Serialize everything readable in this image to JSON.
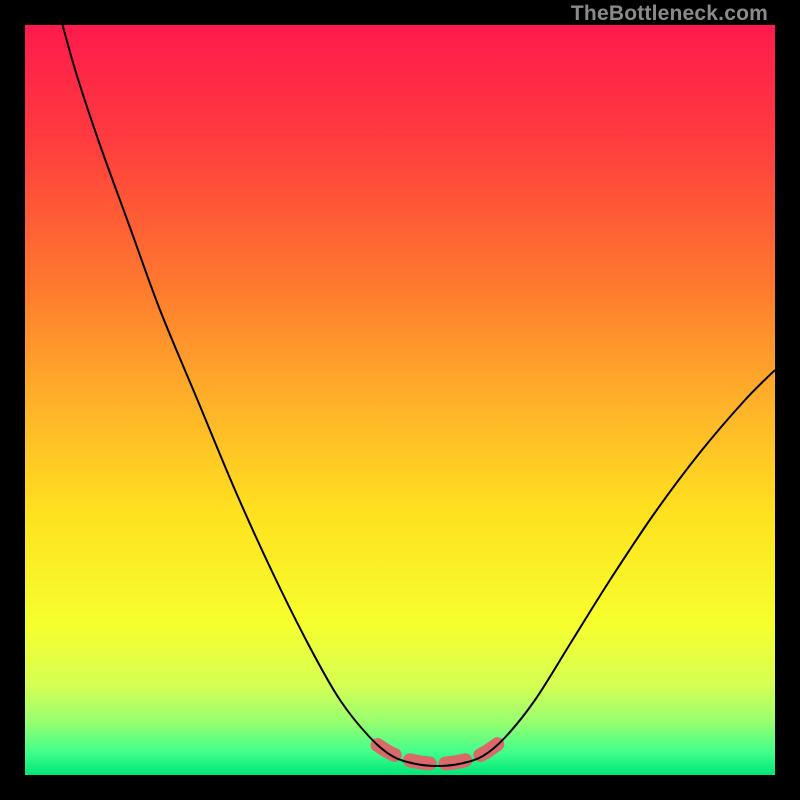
{
  "watermark": "TheBottleneck.com",
  "chart_data": {
    "type": "line",
    "title": "",
    "xlabel": "",
    "ylabel": "",
    "xlim": [
      0,
      100
    ],
    "ylim": [
      0,
      100
    ],
    "gradient_stops": [
      {
        "offset": 0.0,
        "color": "#ff1a4d"
      },
      {
        "offset": 0.15,
        "color": "#ff3b3f"
      },
      {
        "offset": 0.35,
        "color": "#ff7a2e"
      },
      {
        "offset": 0.5,
        "color": "#ffb02a"
      },
      {
        "offset": 0.65,
        "color": "#ffe11f"
      },
      {
        "offset": 0.8,
        "color": "#f6ff2e"
      },
      {
        "offset": 0.88,
        "color": "#d6ff54"
      },
      {
        "offset": 0.93,
        "color": "#96ff70"
      },
      {
        "offset": 0.97,
        "color": "#40ff8c"
      },
      {
        "offset": 1.0,
        "color": "#00e676"
      }
    ],
    "series": [
      {
        "name": "bottleneck-curve",
        "stroke": "#000000",
        "points": [
          {
            "x": 5.0,
            "y": 100.0
          },
          {
            "x": 7.0,
            "y": 93.0
          },
          {
            "x": 10.0,
            "y": 84.0
          },
          {
            "x": 14.0,
            "y": 73.0
          },
          {
            "x": 18.0,
            "y": 62.0
          },
          {
            "x": 23.0,
            "y": 50.0
          },
          {
            "x": 28.0,
            "y": 38.0
          },
          {
            "x": 33.0,
            "y": 27.0
          },
          {
            "x": 38.0,
            "y": 17.0
          },
          {
            "x": 42.0,
            "y": 10.0
          },
          {
            "x": 46.0,
            "y": 5.0
          },
          {
            "x": 49.0,
            "y": 2.5
          },
          {
            "x": 52.0,
            "y": 1.5
          },
          {
            "x": 55.0,
            "y": 1.2
          },
          {
            "x": 58.0,
            "y": 1.5
          },
          {
            "x": 61.0,
            "y": 2.5
          },
          {
            "x": 64.0,
            "y": 5.0
          },
          {
            "x": 68.0,
            "y": 10.0
          },
          {
            "x": 73.0,
            "y": 18.0
          },
          {
            "x": 78.0,
            "y": 26.0
          },
          {
            "x": 84.0,
            "y": 35.0
          },
          {
            "x": 90.0,
            "y": 43.0
          },
          {
            "x": 96.0,
            "y": 50.0
          },
          {
            "x": 100.0,
            "y": 54.0
          }
        ]
      },
      {
        "name": "optimal-range-marker",
        "stroke": "#d86a6a",
        "stroke_width": 14,
        "points": [
          {
            "x": 47.0,
            "y": 4.0
          },
          {
            "x": 49.0,
            "y": 2.8
          },
          {
            "x": 52.0,
            "y": 1.8
          },
          {
            "x": 55.0,
            "y": 1.5
          },
          {
            "x": 58.0,
            "y": 1.8
          },
          {
            "x": 61.0,
            "y": 2.8
          },
          {
            "x": 63.5,
            "y": 4.5
          }
        ]
      }
    ]
  }
}
